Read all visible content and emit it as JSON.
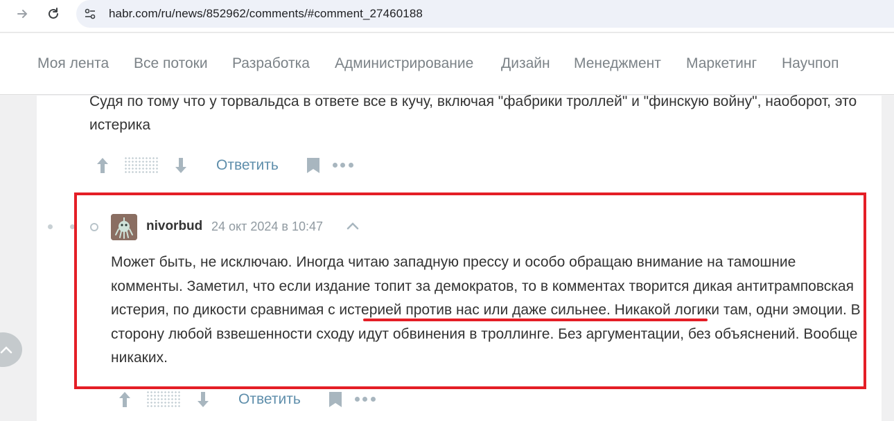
{
  "browser": {
    "url": "habr.com/ru/news/852962/comments/#comment_27460188"
  },
  "nav": {
    "items": [
      "Моя лента",
      "Все потоки",
      "Разработка",
      "Администрирование",
      "Дизайн",
      "Менеджмент",
      "Маркетинг",
      "Научпоп"
    ]
  },
  "previous_comment": {
    "text": "Судя по тому что у торвальдса в ответе все в кучу, включая \"фабрики троллей\" и \"финскую войну\", наоборот, это истерика",
    "reply_label": "Ответить"
  },
  "comment": {
    "username": "nivorbud",
    "date": "24 окт 2024 в 10:47",
    "text_before": "Может быть, не исключаю. Иногда читаю западную прессу и особо обращаю внимание на тамошние комменты. Заметил, что если издание топит за демократов, то в комментах творится дикая антитрамповская истерия, ",
    "text_underlined": "по дикости сравнимая с истерией против нас",
    "text_after": " или даже сильнее. Никакой логики там, одни эмоции. В сторону любой взвешенности сходу идут обвинения в троллинге. Без аргументации, без объяснений. Вообще никаких.",
    "reply_label": "Ответить"
  },
  "colors": {
    "highlight": "#e41e26",
    "link": "#5e8eab"
  }
}
